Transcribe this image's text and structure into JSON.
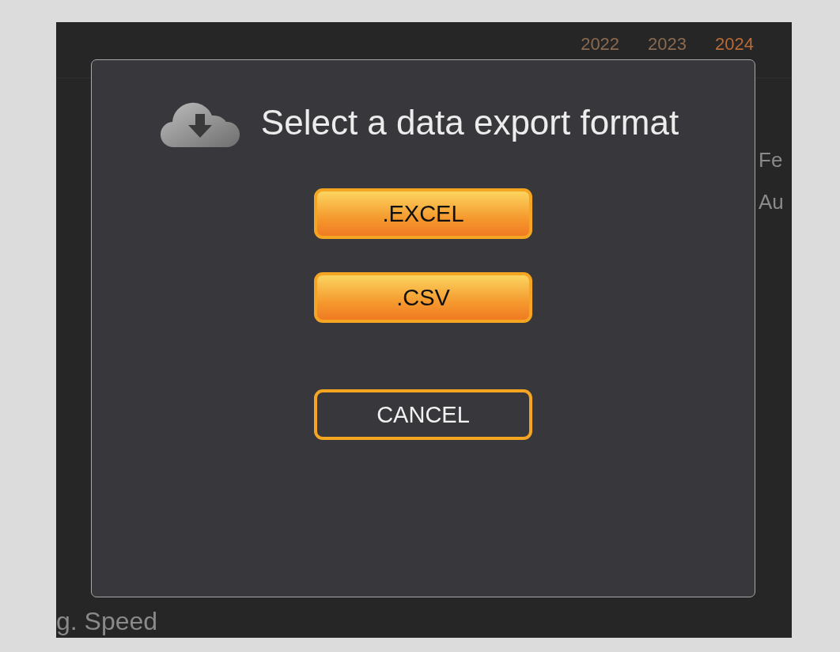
{
  "background": {
    "years": [
      {
        "label": "2022",
        "selected": false
      },
      {
        "label": "2023",
        "selected": false
      },
      {
        "label": "2024",
        "selected": true
      }
    ],
    "months": [
      {
        "label": "Fe"
      },
      {
        "label": "Au"
      }
    ],
    "metric_label": "g. Speed"
  },
  "dialog": {
    "title": "Select a data export format",
    "buttons": [
      {
        "label": ".EXCEL",
        "kind": "primary"
      },
      {
        "label": ".CSV",
        "kind": "primary"
      },
      {
        "label": "CANCEL",
        "kind": "outline"
      }
    ]
  }
}
